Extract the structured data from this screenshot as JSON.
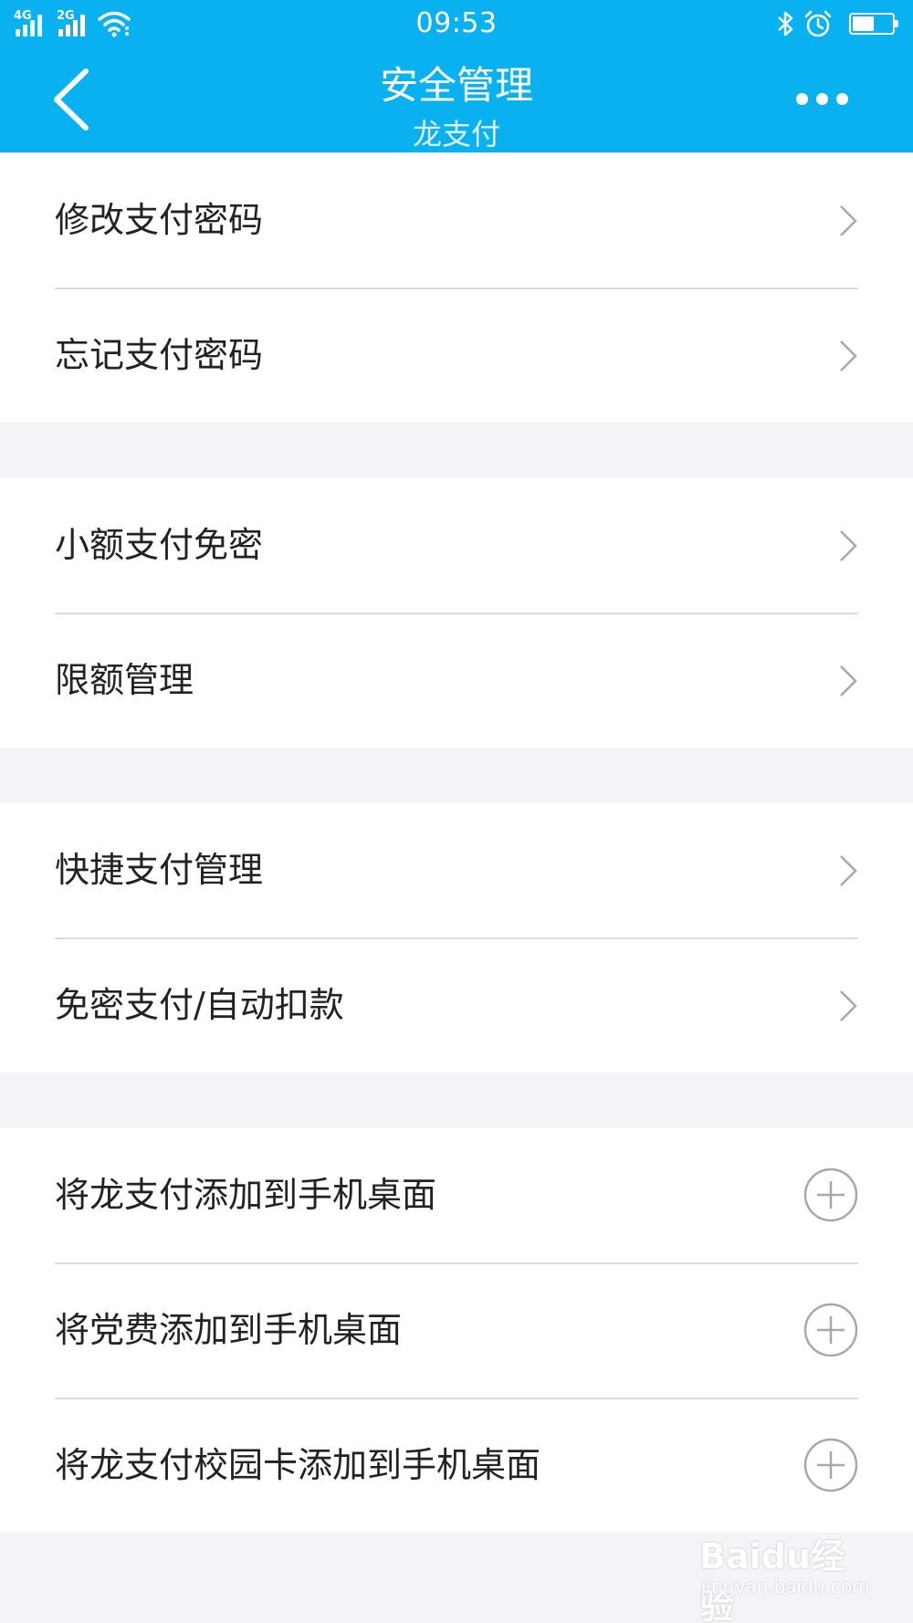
{
  "status_bar": {
    "signal_1_tag": "4G",
    "signal_2_tag": "2G",
    "time": "09:53",
    "battery_level": 0.55
  },
  "nav": {
    "title": "安全管理",
    "subtitle": "龙支付",
    "back_icon": "back-chevron-icon",
    "more_icon": "more-dots-icon"
  },
  "groups": [
    {
      "items": [
        {
          "label": "修改支付密码",
          "icon": "chevron-right-icon"
        },
        {
          "label": "忘记支付密码",
          "icon": "chevron-right-icon"
        }
      ]
    },
    {
      "items": [
        {
          "label": "小额支付免密",
          "icon": "chevron-right-icon"
        },
        {
          "label": "限额管理",
          "icon": "chevron-right-icon"
        }
      ]
    },
    {
      "items": [
        {
          "label": "快捷支付管理",
          "icon": "chevron-right-icon"
        },
        {
          "label": "免密支付/自动扣款",
          "icon": "chevron-right-icon"
        }
      ]
    },
    {
      "items": [
        {
          "label": "将龙支付添加到手机桌面",
          "icon": "plus-circle-icon"
        },
        {
          "label": "将党费添加到手机桌面",
          "icon": "plus-circle-icon"
        },
        {
          "label": "将龙支付校园卡添加到手机桌面",
          "icon": "plus-circle-icon"
        }
      ]
    }
  ],
  "watermark": {
    "brand": "Baidu经验",
    "url": "jingyan.baidu.com"
  },
  "colors": {
    "header_bg": "#0ab1f0",
    "page_bg": "#f2f4f7",
    "row_bg": "#ffffff",
    "text": "#222222",
    "divider": "#dcdcdc",
    "icon_gray": "#a8a8a8"
  }
}
